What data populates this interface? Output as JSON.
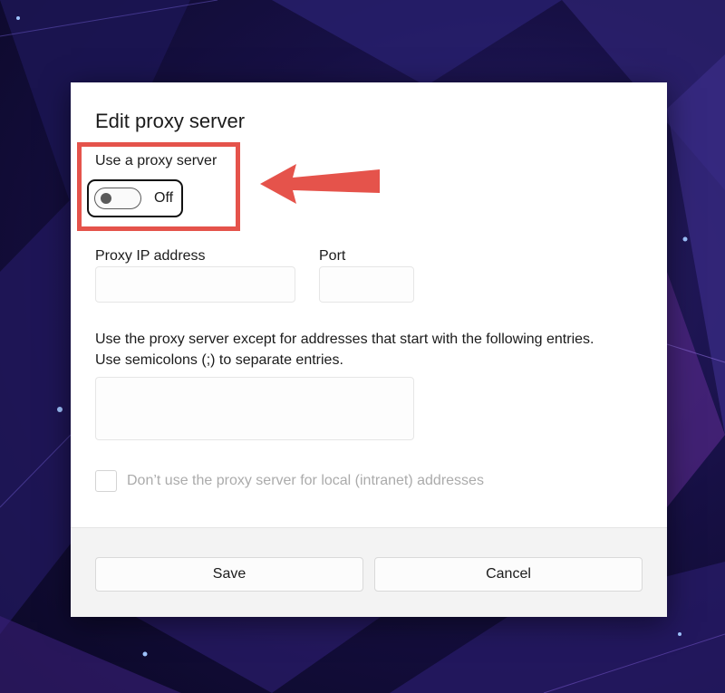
{
  "dialog": {
    "title": "Edit proxy server",
    "proxy_toggle": {
      "label": "Use a proxy server",
      "state": "Off",
      "on": false
    },
    "proxy_ip": {
      "label": "Proxy IP address",
      "value": ""
    },
    "port": {
      "label": "Port",
      "value": ""
    },
    "exceptions": {
      "description_line1": "Use the proxy server except for addresses that start with the following entries.",
      "description_line2": "Use semicolons (;) to separate entries.",
      "value": ""
    },
    "local_checkbox": {
      "label": "Don’t use the proxy server for local (intranet) addresses",
      "checked": false,
      "enabled": false
    },
    "buttons": {
      "save": "Save",
      "cancel": "Cancel"
    }
  },
  "annotation": {
    "color": "#e5534b",
    "arrow_icon": "left-arrow-icon"
  }
}
